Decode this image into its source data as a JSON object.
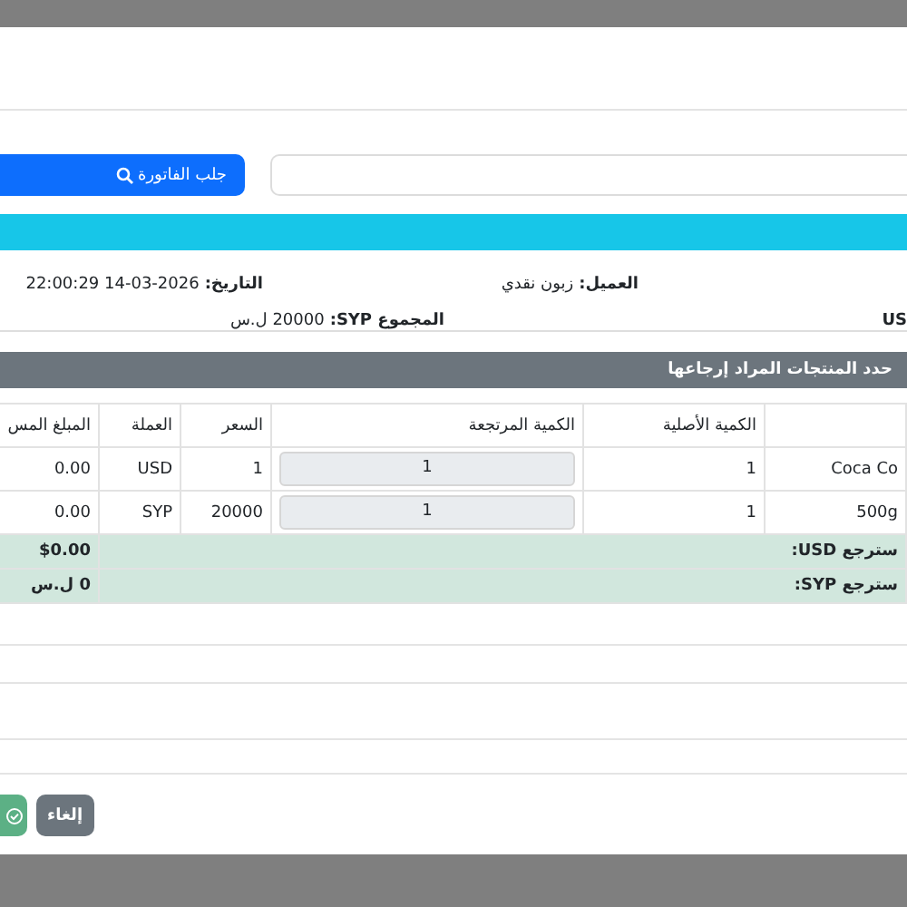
{
  "fetch": {
    "button": "جلب الفاتورة"
  },
  "info": [
    {
      "label": "العميل:",
      "value": "زبون نقدي"
    },
    {
      "label": "التاريخ:",
      "value": "14-03-2026 22:00:29"
    },
    {
      "label": "US"
    },
    {
      "label": "المجموع SYP:",
      "value": "20000 ل.س"
    }
  ],
  "section_title": "حدد المنتجات المراد إرجاعها",
  "table": {
    "columns": [
      "الكمية الأصلية",
      "الكمية المرتجعة",
      "السعر",
      "العملة",
      "المبلغ المس"
    ],
    "rows": [
      {
        "product": "Coca Co",
        "original_qty": "1",
        "returned_qty": "1",
        "price": "1",
        "currency": "USD",
        "amount": "0.00"
      },
      {
        "product": "500g",
        "original_qty": "1",
        "returned_qty": "1",
        "price": "20000",
        "currency": "SYP",
        "amount": "0.00"
      }
    ]
  },
  "totals": [
    {
      "label": "سترجع USD:",
      "value": "$0.00"
    },
    {
      "label": "سترجع SYP:",
      "value": "0 ل.س"
    }
  ],
  "buttons": {
    "cancel": "إلغاء"
  }
}
